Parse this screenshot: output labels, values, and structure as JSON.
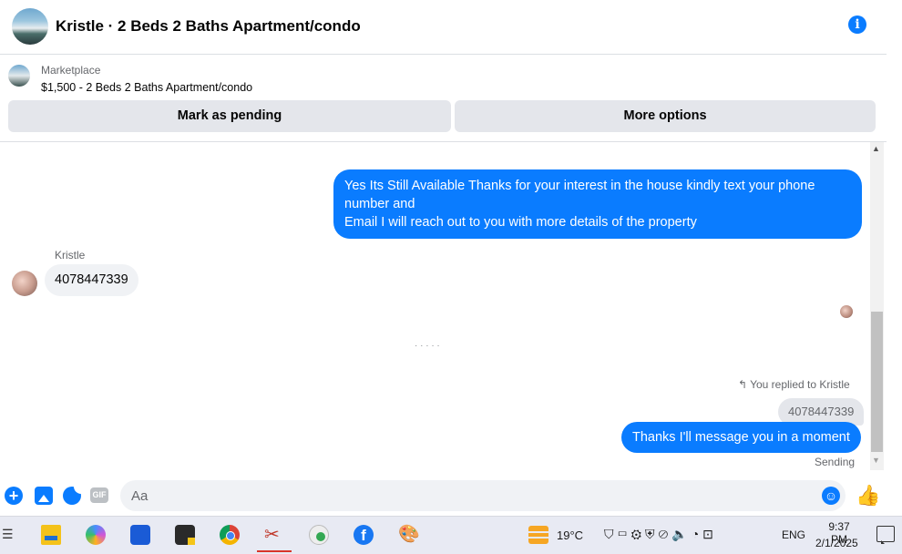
{
  "header": {
    "title": "Kristle · 2 Beds 2 Baths Apartment/condo",
    "info_icon": "i"
  },
  "marketplace": {
    "label": "Marketplace",
    "listing": "$1,500 - 2 Beds 2 Baths Apartment/condo",
    "buttons": {
      "pending": "Mark as pending",
      "more": "More options"
    }
  },
  "conversation": {
    "messages": [
      {
        "direction": "outgoing",
        "lines": [
          "Yes Its Still Available Thanks for your interest in the house kindly text your phone number and",
          "Email I will reach out to you with more details of the property"
        ]
      },
      {
        "direction": "incoming",
        "sender": "Kristle",
        "text": "4078447339"
      },
      {
        "direction": "outgoing",
        "reply_note": "You replied to Kristle",
        "quoted": "4078447339",
        "text": "Thanks I'll message you in a moment",
        "status": "Sending"
      }
    ]
  },
  "composer": {
    "placeholder": "Aa",
    "like_icon": "👍"
  },
  "taskbar": {
    "weather": {
      "temp": "19°C"
    },
    "language": "ENG",
    "time": "9:37 PM",
    "date": "2/1/2025",
    "facebook_glyph": "f"
  },
  "colors": {
    "accent": "#0a7cff",
    "incoming_bubble": "#f0f2f5",
    "button_bg": "#e4e6eb"
  }
}
